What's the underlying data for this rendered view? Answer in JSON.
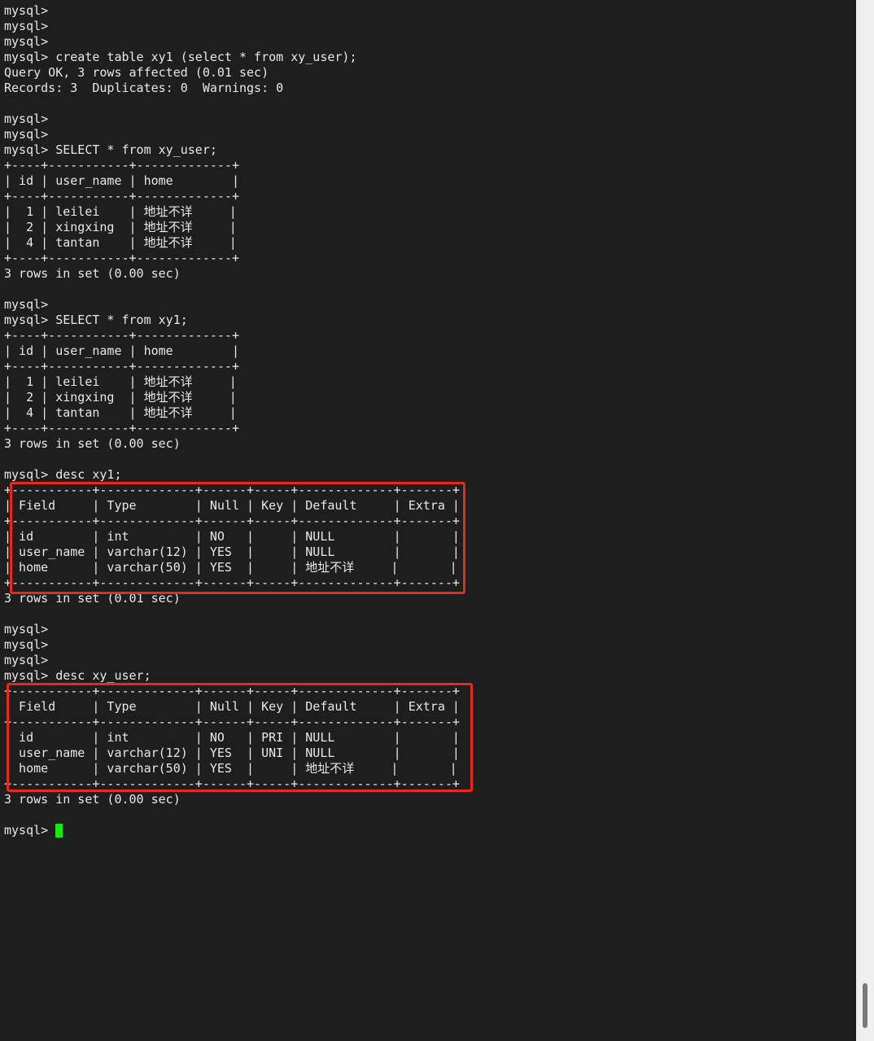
{
  "terminal": {
    "lines": [
      "mysql>",
      "mysql>",
      "mysql>",
      "mysql> create table xy1 (select * from xy_user);",
      "Query OK, 3 rows affected (0.01 sec)",
      "Records: 3  Duplicates: 0  Warnings: 0",
      "",
      "mysql>",
      "mysql>",
      "mysql> SELECT * from xy_user;",
      "+----+-----------+-------------+",
      "| id | user_name | home        |",
      "+----+-----------+-------------+",
      "|  1 | leilei    | 地址不详     |",
      "|  2 | xingxing  | 地址不详     |",
      "|  4 | tantan    | 地址不详     |",
      "+----+-----------+-------------+",
      "3 rows in set (0.00 sec)",
      "",
      "mysql>",
      "mysql> SELECT * from xy1;",
      "+----+-----------+-------------+",
      "| id | user_name | home        |",
      "+----+-----------+-------------+",
      "|  1 | leilei    | 地址不详     |",
      "|  2 | xingxing  | 地址不详     |",
      "|  4 | tantan    | 地址不详     |",
      "+----+-----------+-------------+",
      "3 rows in set (0.00 sec)",
      "",
      "mysql> desc xy1;",
      "+-----------+-------------+------+-----+-------------+-------+",
      "| Field     | Type        | Null | Key | Default     | Extra |",
      "+-----------+-------------+------+-----+-------------+-------+",
      "| id        | int         | NO   |     | NULL        |       |",
      "| user_name | varchar(12) | YES  |     | NULL        |       |",
      "| home      | varchar(50) | YES  |     | 地址不详     |       |",
      "+-----------+-------------+------+-----+-------------+-------+",
      "3 rows in set (0.01 sec)",
      "",
      "mysql>",
      "mysql>",
      "mysql>",
      "mysql> desc xy_user;",
      "+-----------+-------------+------+-----+-------------+-------+",
      "| Field     | Type        | Null | Key | Default     | Extra |",
      "+-----------+-------------+------+-----+-------------+-------+",
      "| id        | int         | NO   | PRI | NULL        |       |",
      "| user_name | varchar(12) | YES  | UNI | NULL        |       |",
      "| home      | varchar(50) | YES  |     | 地址不详     |       |",
      "+-----------+-------------+------+-----+-------------+-------+",
      "3 rows in set (0.00 sec)",
      "",
      "mysql> "
    ]
  },
  "colors": {
    "background": "#1e1e1e",
    "text": "#e8e8e8",
    "cursor": "#19e60c",
    "highlight": "#e8281f",
    "scrollbar_track": "#f0f0f0",
    "scrollbar_thumb": "#7a7a7a"
  }
}
